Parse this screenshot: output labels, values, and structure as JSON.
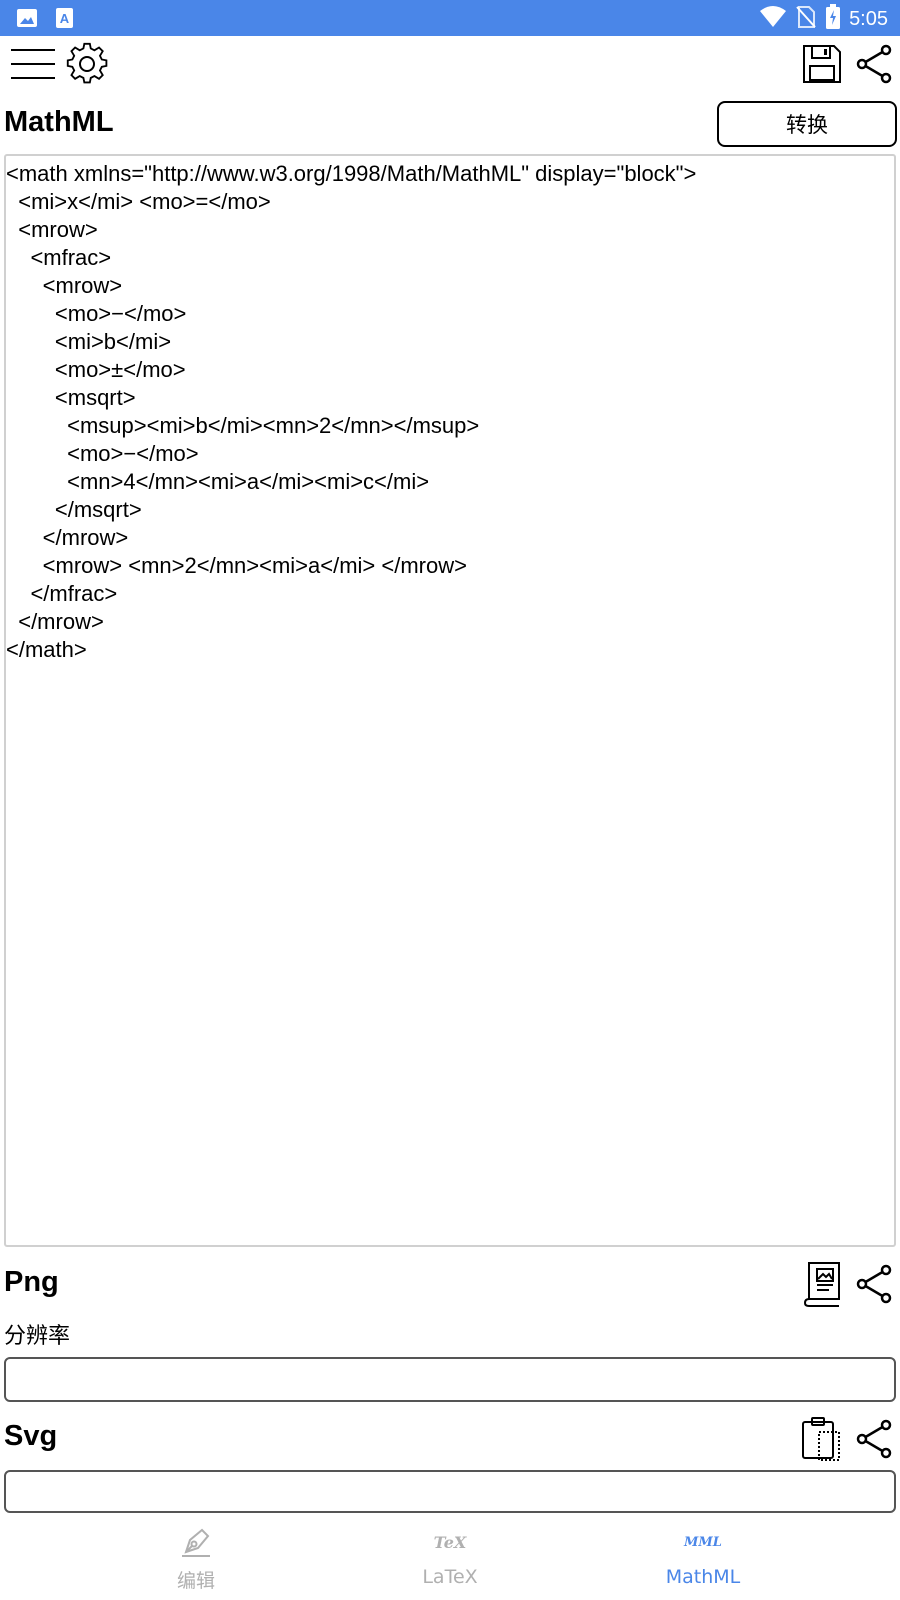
{
  "status_bar": {
    "time": "5:05",
    "left_icons": [
      "image-notification-icon",
      "translate-notification-icon"
    ],
    "right_icons": [
      "wifi-icon",
      "no-sim-icon",
      "battery-charging-icon"
    ]
  },
  "appbar": {
    "icons": [
      "menu-icon",
      "gear-icon",
      "save-icon",
      "share-icon"
    ]
  },
  "mathml_section": {
    "title": "MathML",
    "convert_label": "转换",
    "code_lines": [
      "<math xmlns=\"http://www.w3.org/1998/Math/MathML\" display=\"block\">",
      "  <mi>x</mi> <mo>=</mo>",
      "  <mrow>",
      "    <mfrac>",
      "      <mrow>",
      "        <mo>−</mo>",
      "        <mi>b</mi>",
      "        <mo>±</mo>",
      "        <msqrt>",
      "          <msup><mi>b</mi><mn>2</mn></msup>",
      "          <mo>−</mo>",
      "          <mn>4</mn><mi>a</mi><mi>c</mi>",
      "        </msqrt>",
      "      </mrow>",
      "      <mrow> <mn>2</mn><mi>a</mi> </mrow>",
      "    </mfrac>",
      "  </mrow>",
      "</math>"
    ]
  },
  "png_section": {
    "title": "Png",
    "resolution_label": "分辨率",
    "resolution_value": ""
  },
  "svg_section": {
    "title": "Svg",
    "svg_value": ""
  },
  "bottom_nav": {
    "items": [
      {
        "label": "编辑",
        "icon": "pen-icon",
        "active": false
      },
      {
        "label": "LaTeX",
        "icon_text": "TeX",
        "active": false
      },
      {
        "label": "MathML",
        "icon_text": "MML",
        "active": true
      }
    ]
  },
  "colors": {
    "status_bar": "#4a86e8",
    "active_nav": "#4a86e8",
    "inactive_nav": "#b0b0b0"
  }
}
